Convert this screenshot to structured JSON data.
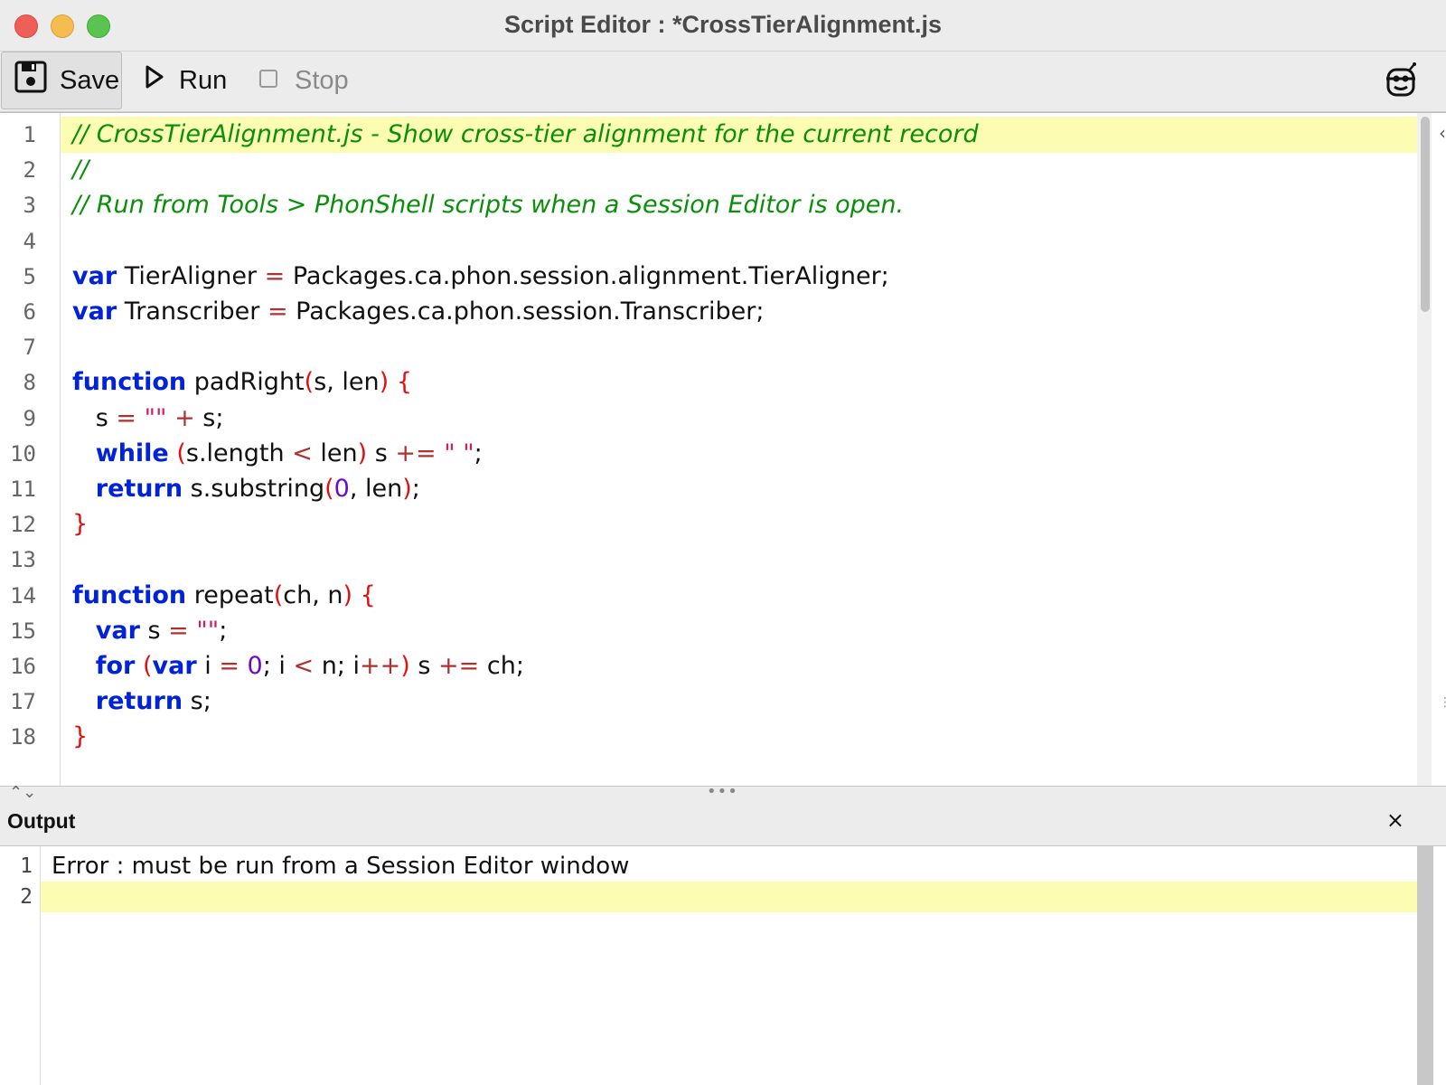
{
  "window": {
    "title": "Script Editor : *CrossTierAlignment.js"
  },
  "toolbar": {
    "save_label": "Save",
    "run_label": "Run",
    "stop_label": "Stop",
    "save_icon": "floppy-disk-icon",
    "run_icon": "play-icon",
    "stop_icon": "stop-square-icon",
    "robot_icon": "robot-icon"
  },
  "editor": {
    "lines": [
      {
        "n": "1",
        "tokens": [
          {
            "t": "cm",
            "v": "// CrossTierAlignment.js - Show cross-tier alignment for the current record"
          }
        ]
      },
      {
        "n": "2",
        "tokens": [
          {
            "t": "cm",
            "v": "//"
          }
        ]
      },
      {
        "n": "3",
        "tokens": [
          {
            "t": "cm",
            "v": "// Run from Tools > PhonShell scripts when a Session Editor is open."
          }
        ]
      },
      {
        "n": "4",
        "tokens": []
      },
      {
        "n": "5",
        "tokens": [
          {
            "t": "kw",
            "v": "var"
          },
          {
            "t": "",
            "v": " TierAligner "
          },
          {
            "t": "op",
            "v": "="
          },
          {
            "t": "",
            "v": " Packages.ca.phon.session.alignment.TierAligner;"
          }
        ]
      },
      {
        "n": "6",
        "tokens": [
          {
            "t": "kw",
            "v": "var"
          },
          {
            "t": "",
            "v": " Transcriber "
          },
          {
            "t": "op",
            "v": "="
          },
          {
            "t": "",
            "v": " Packages.ca.phon.session.Transcriber;"
          }
        ]
      },
      {
        "n": "7",
        "tokens": []
      },
      {
        "n": "8",
        "tokens": [
          {
            "t": "kw",
            "v": "function"
          },
          {
            "t": "",
            "v": " padRight"
          },
          {
            "t": "br",
            "v": "("
          },
          {
            "t": "",
            "v": "s, len"
          },
          {
            "t": "br",
            "v": ")"
          },
          {
            "t": "",
            "v": " "
          },
          {
            "t": "br",
            "v": "{"
          }
        ]
      },
      {
        "n": "9",
        "tokens": [
          {
            "t": "",
            "v": "   s "
          },
          {
            "t": "op",
            "v": "="
          },
          {
            "t": "",
            "v": " "
          },
          {
            "t": "st",
            "v": "\"\""
          },
          {
            "t": "",
            "v": " "
          },
          {
            "t": "op",
            "v": "+"
          },
          {
            "t": "",
            "v": " s;"
          }
        ]
      },
      {
        "n": "10",
        "tokens": [
          {
            "t": "",
            "v": "   "
          },
          {
            "t": "kw",
            "v": "while"
          },
          {
            "t": "",
            "v": " "
          },
          {
            "t": "br",
            "v": "("
          },
          {
            "t": "",
            "v": "s.length "
          },
          {
            "t": "op",
            "v": "<"
          },
          {
            "t": "",
            "v": " len"
          },
          {
            "t": "br",
            "v": ")"
          },
          {
            "t": "",
            "v": " s "
          },
          {
            "t": "op",
            "v": "+="
          },
          {
            "t": "",
            "v": " "
          },
          {
            "t": "st",
            "v": "\" \""
          },
          {
            "t": "",
            "v": ";"
          }
        ]
      },
      {
        "n": "11",
        "tokens": [
          {
            "t": "",
            "v": "   "
          },
          {
            "t": "kw",
            "v": "return"
          },
          {
            "t": "",
            "v": " s.substring"
          },
          {
            "t": "br",
            "v": "("
          },
          {
            "t": "nm",
            "v": "0"
          },
          {
            "t": "",
            "v": ", len"
          },
          {
            "t": "br",
            "v": ")"
          },
          {
            "t": "",
            "v": ";"
          }
        ]
      },
      {
        "n": "12",
        "tokens": [
          {
            "t": "br",
            "v": "}"
          }
        ]
      },
      {
        "n": "13",
        "tokens": []
      },
      {
        "n": "14",
        "tokens": [
          {
            "t": "kw",
            "v": "function"
          },
          {
            "t": "",
            "v": " repeat"
          },
          {
            "t": "br",
            "v": "("
          },
          {
            "t": "",
            "v": "ch, n"
          },
          {
            "t": "br",
            "v": ")"
          },
          {
            "t": "",
            "v": " "
          },
          {
            "t": "br",
            "v": "{"
          }
        ]
      },
      {
        "n": "15",
        "tokens": [
          {
            "t": "",
            "v": "   "
          },
          {
            "t": "kw",
            "v": "var"
          },
          {
            "t": "",
            "v": " s "
          },
          {
            "t": "op",
            "v": "="
          },
          {
            "t": "",
            "v": " "
          },
          {
            "t": "st",
            "v": "\"\""
          },
          {
            "t": "",
            "v": ";"
          }
        ]
      },
      {
        "n": "16",
        "tokens": [
          {
            "t": "",
            "v": "   "
          },
          {
            "t": "kw",
            "v": "for"
          },
          {
            "t": "",
            "v": " "
          },
          {
            "t": "br",
            "v": "("
          },
          {
            "t": "kw",
            "v": "var"
          },
          {
            "t": "",
            "v": " i "
          },
          {
            "t": "op",
            "v": "="
          },
          {
            "t": "",
            "v": " "
          },
          {
            "t": "nm",
            "v": "0"
          },
          {
            "t": "",
            "v": "; i "
          },
          {
            "t": "op",
            "v": "<"
          },
          {
            "t": "",
            "v": " n; i"
          },
          {
            "t": "op",
            "v": "++"
          },
          {
            "t": "br",
            "v": ")"
          },
          {
            "t": "",
            "v": " s "
          },
          {
            "t": "op",
            "v": "+="
          },
          {
            "t": "",
            "v": " ch;"
          }
        ]
      },
      {
        "n": "17",
        "tokens": [
          {
            "t": "",
            "v": "   "
          },
          {
            "t": "kw",
            "v": "return"
          },
          {
            "t": "",
            "v": " s;"
          }
        ]
      },
      {
        "n": "18",
        "tokens": [
          {
            "t": "br",
            "v": "}"
          }
        ]
      }
    ],
    "highlighted_line": "1"
  },
  "output": {
    "title": "Output",
    "close_label": "×",
    "lines": [
      {
        "n": "1",
        "text": "Error : must be run from a Session Editor window"
      },
      {
        "n": "2",
        "text": ""
      }
    ],
    "highlighted_line": "2"
  },
  "colors": {
    "line_highlight": "#fcfcb2",
    "comment": "#0a8f0a",
    "keyword": "#0022d8",
    "bracket": "#e01010",
    "string": "#cf1f60",
    "number": "#6a0cc4"
  }
}
